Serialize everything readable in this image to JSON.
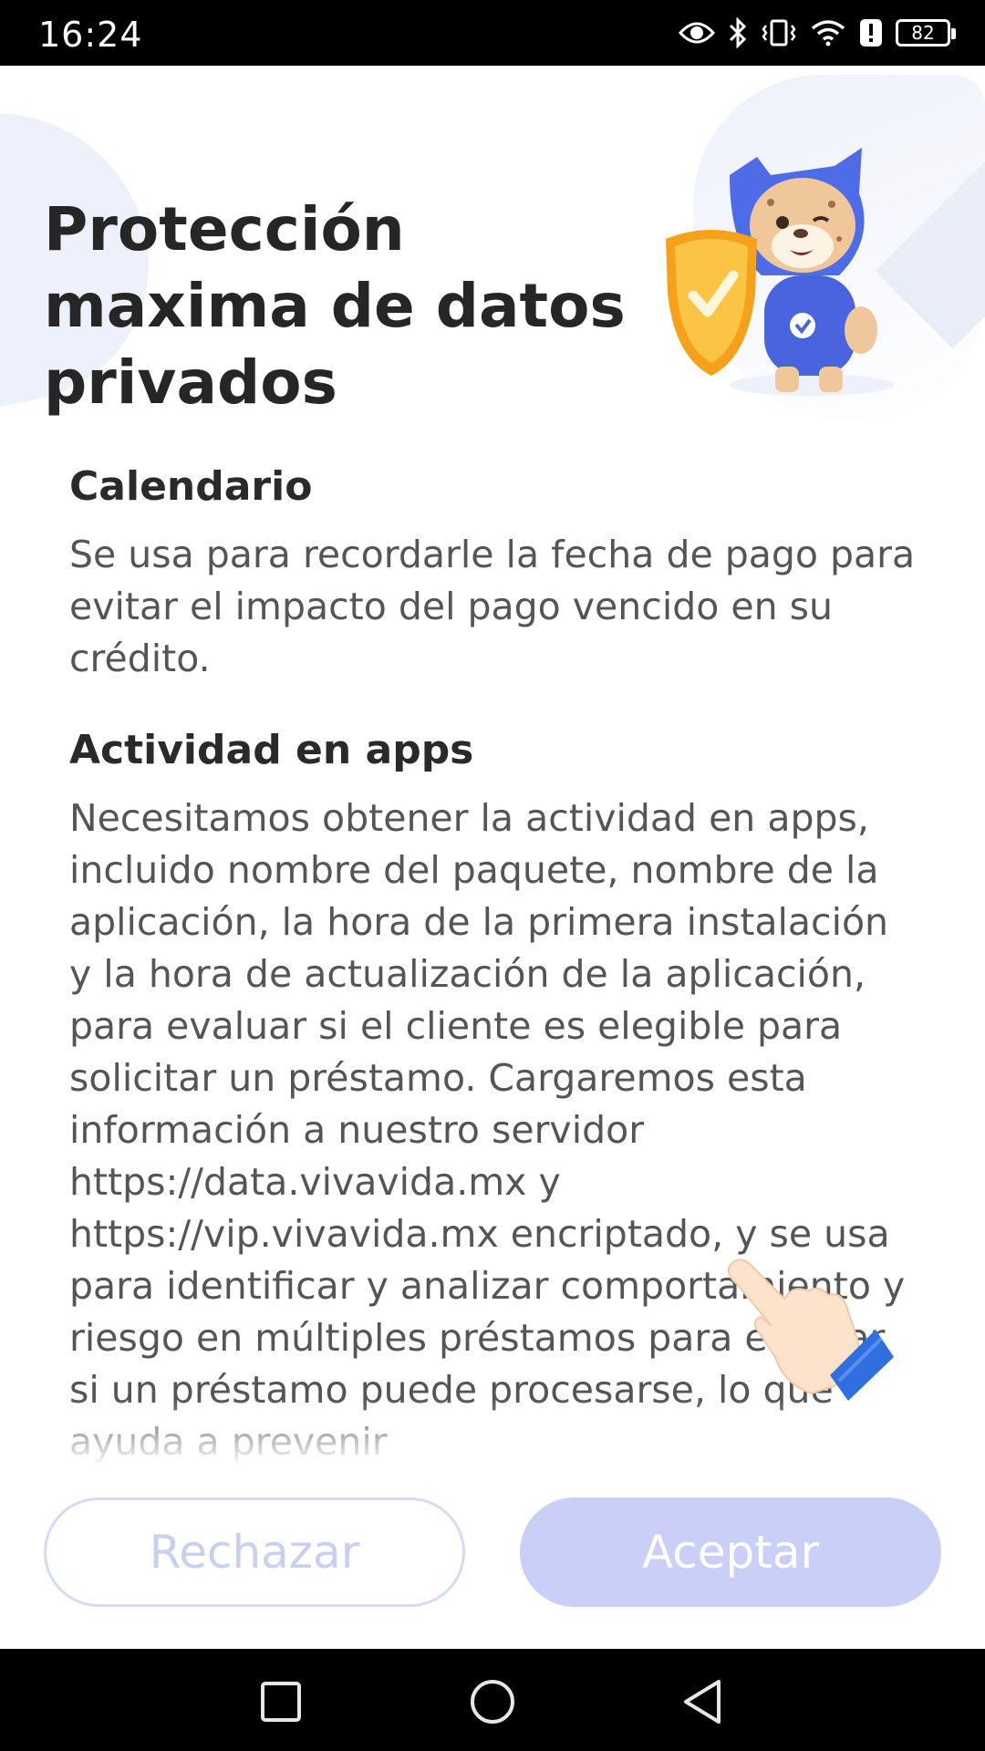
{
  "status_bar": {
    "time": "16:24",
    "battery": "82",
    "icons": [
      "eye-icon",
      "bluetooth-icon",
      "vibrate-icon",
      "wifi-icon",
      "alert-icon",
      "battery-icon"
    ]
  },
  "header": {
    "title": "Protección maxima de datos privados",
    "illustration": "mascot-with-shield"
  },
  "sections": [
    {
      "title": "Calendario",
      "body": "Se usa para recordarle la fecha de pago para evitar el impacto del pago vencido en su crédito."
    },
    {
      "title": "Actividad en apps",
      "body": "Necesitamos obtener la actividad en apps, incluido nombre del paquete, nombre de la aplicación, la hora de la primera instalación y la hora de actualización de la aplicación, para evaluar si el cliente es elegible para solicitar un préstamo. Cargaremos esta información a nuestro servidor https://data.vivavida.mx y https://vip.vivavida.mx encriptado, y se usa para identificar y analizar comportamiento y riesgo en múltiples préstamos para evaluar si un préstamo puede procesarse, lo que ayuda a prevenir"
    }
  ],
  "buttons": {
    "reject": "Rechazar",
    "accept": "Aceptar"
  },
  "nav": {
    "icons": [
      "recents-icon",
      "home-icon",
      "back-icon"
    ]
  },
  "colors": {
    "accent": "#c9cff6",
    "reject_text": "#c9cff2",
    "title_text": "#262626",
    "body_text": "#555555"
  }
}
